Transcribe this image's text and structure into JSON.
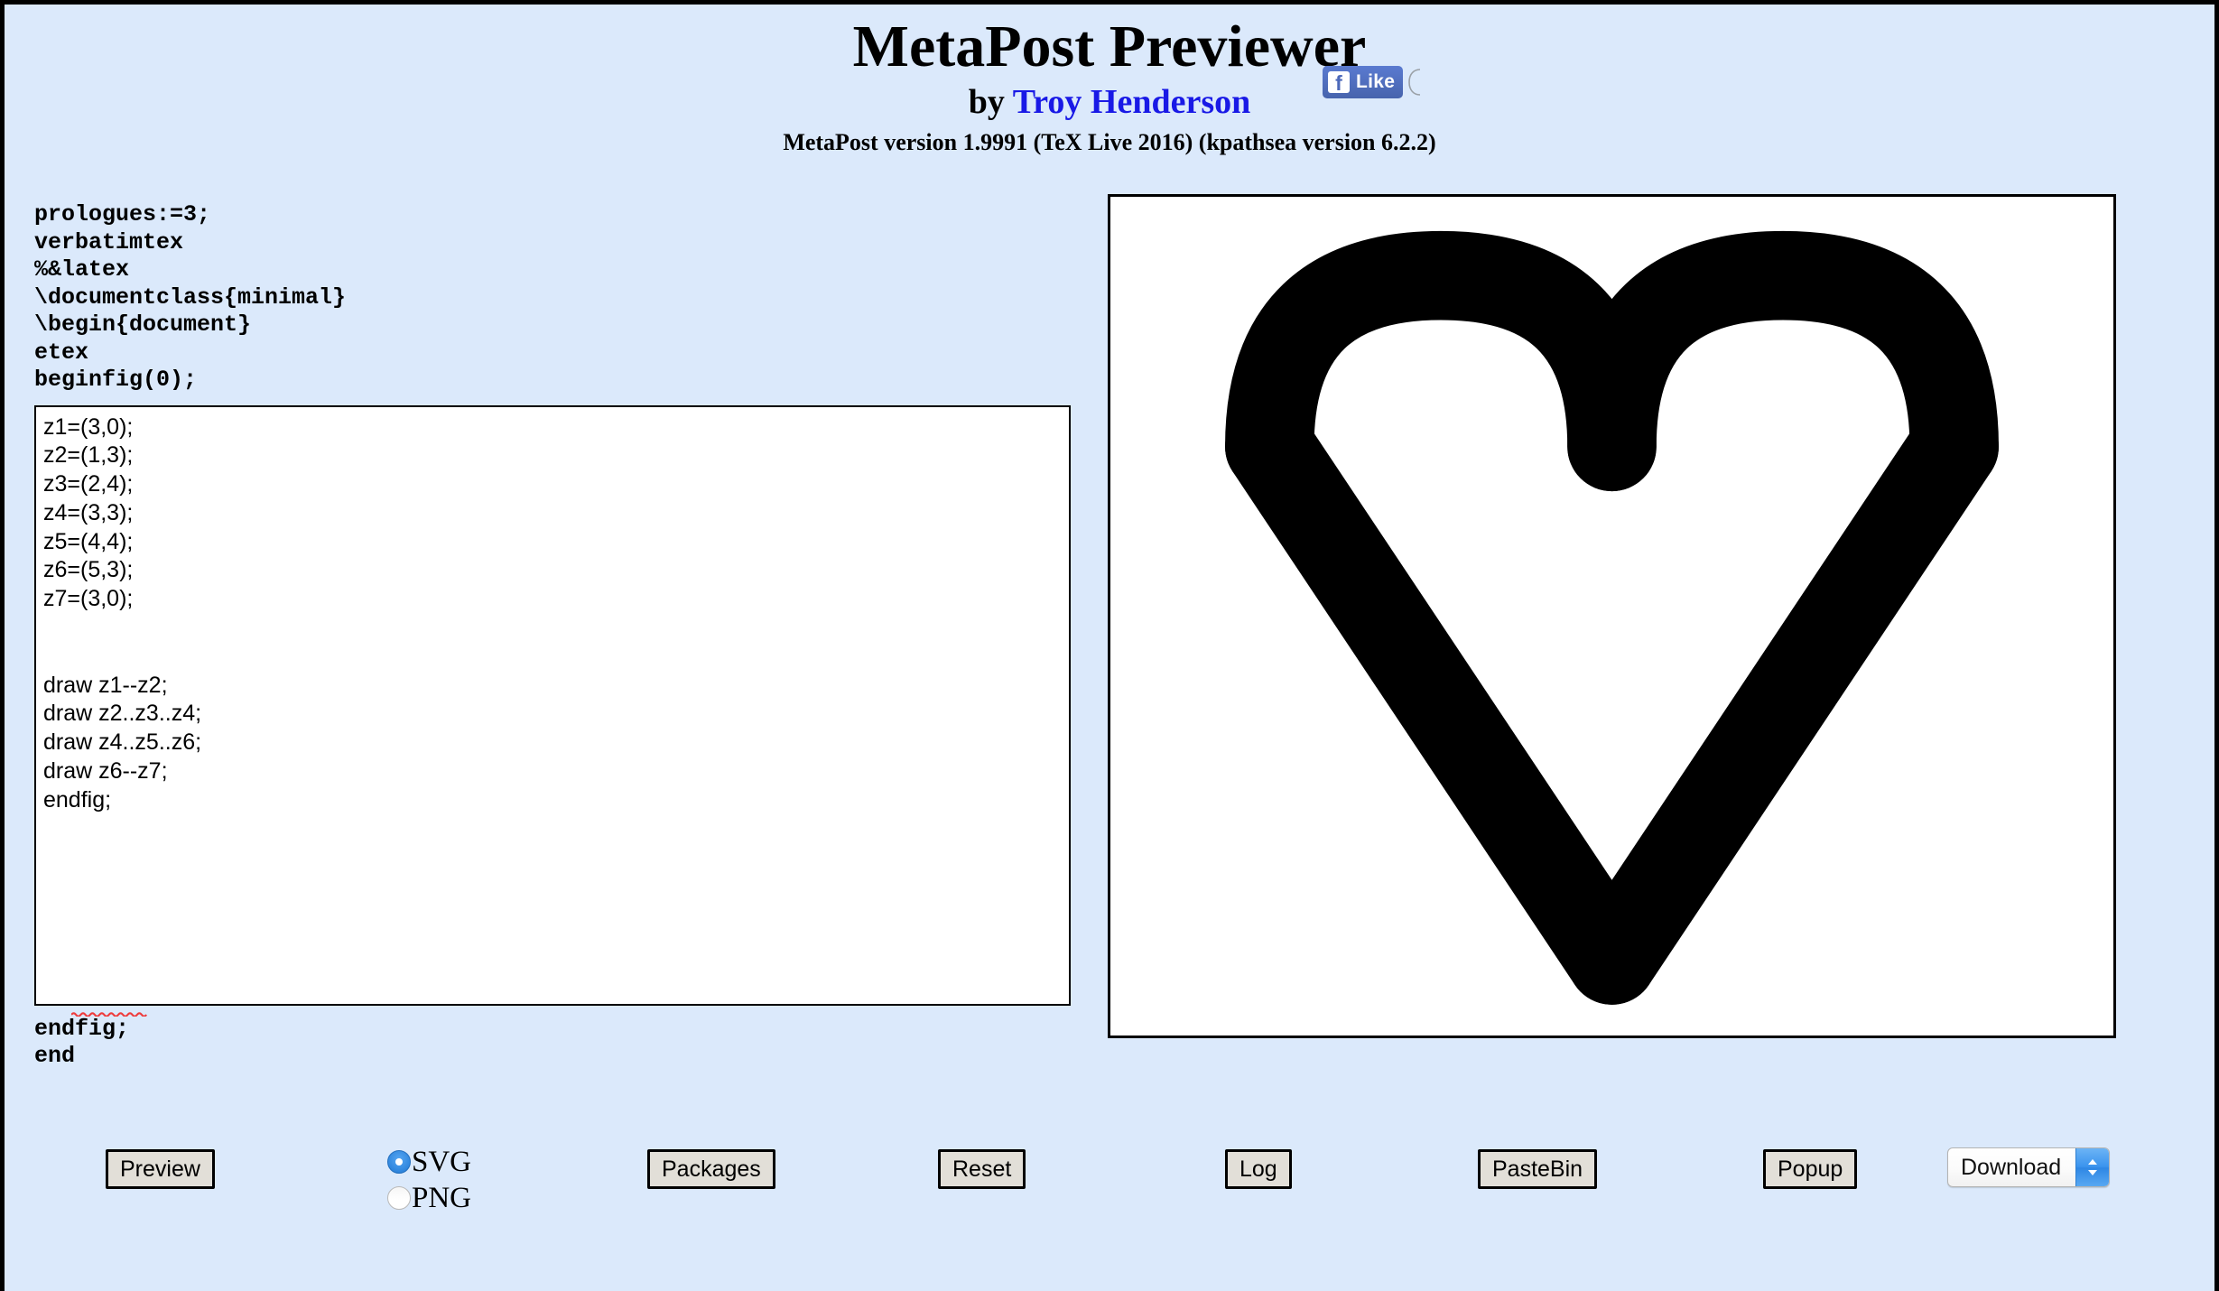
{
  "header": {
    "title": "MetaPost Previewer",
    "by_prefix": "by ",
    "author": "Troy Henderson",
    "version_line": "MetaPost version 1.9991 (TeX Live 2016) (kpathsea version 6.2.2)",
    "author_link_color": "#1919e6"
  },
  "social": {
    "fb_glyph": "f",
    "fb_like_label": "Like",
    "fb_button_color": "#4c69ba"
  },
  "editor": {
    "preamble": "prologues:=3;\nverbatimtex\n%&latex\n\\documentclass{minimal}\n\\begin{document}\netex\nbeginfig(0);",
    "figure_body": "z1=(3,0);\nz2=(1,3);\nz3=(2,4);\nz4=(3,3);\nz5=(4,4);\nz6=(5,3);\nz7=(3,0);\n\n\ndraw z1--z2;\ndraw z2..z3..z4;\ndraw z4..z5..z6;\ndraw z6--z7;\nendfig;",
    "postamble": "endfig;\nend"
  },
  "preview": {
    "background": "#ffffff",
    "ink_color": "#000000",
    "figure_points": {
      "z1": [
        3,
        0
      ],
      "z2": [
        1,
        3
      ],
      "z3": [
        2,
        4
      ],
      "z4": [
        3,
        3
      ],
      "z5": [
        4,
        4
      ],
      "z6": [
        5,
        3
      ],
      "z7": [
        3,
        0
      ]
    },
    "figure_paths": [
      "draw z1--z2;",
      "draw z2..z3..z4;",
      "draw z4..z5..z6;",
      "draw z6--z7;"
    ]
  },
  "controls": {
    "preview_label": "Preview",
    "packages_label": "Packages",
    "reset_label": "Reset",
    "log_label": "Log",
    "pastebin_label": "PasteBin",
    "popup_label": "Popup",
    "format": {
      "options": [
        "SVG",
        "PNG"
      ],
      "selected": "SVG"
    },
    "download": {
      "selected": "Download"
    }
  },
  "colors": {
    "page_background": "#dbe9fb",
    "button_face": "#e2dfd8",
    "radio_selected": "#3a93e8"
  }
}
